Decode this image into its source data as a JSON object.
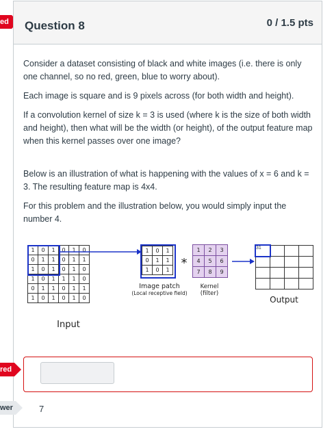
{
  "tags": {
    "top": "ed",
    "middle": "red",
    "bottom": "wer"
  },
  "question": {
    "title": "Question 8",
    "points": "0 / 1.5 pts",
    "p1": "Consider a dataset consisting of black and white images (i.e. there is only one channel, so no red, green, blue to worry about).",
    "p2": "Each image is square and is 9 pixels across (for both width and height).",
    "p3": "If a convolution kernel of size k = 3 is used (where k is the size of both width and height), then what will be the width (or height), of the output feature map when this kernel passes over one image?",
    "p4": "Below is an illustration of what is happening with the values of x = 6 and k = 3. The resulting feature map is 4x4.",
    "p5": "For this problem and the illustration below, you would simply input the number 4."
  },
  "figure": {
    "input_matrix": [
      [
        "1",
        "0",
        "1",
        "0",
        "1",
        "0"
      ],
      [
        "0",
        "1",
        "1",
        "0",
        "1",
        "1"
      ],
      [
        "1",
        "0",
        "1",
        "0",
        "1",
        "0"
      ],
      [
        "1",
        "0",
        "1",
        "1",
        "1",
        "0"
      ],
      [
        "0",
        "1",
        "1",
        "0",
        "1",
        "1"
      ],
      [
        "1",
        "0",
        "1",
        "0",
        "1",
        "0"
      ]
    ],
    "input_label": "Input",
    "patch_matrix": [
      [
        "1",
        "0",
        "1"
      ],
      [
        "0",
        "1",
        "1"
      ],
      [
        "1",
        "0",
        "1"
      ]
    ],
    "patch_label_1": "Image patch",
    "patch_label_2": "(Local receptive field)",
    "star": "*",
    "kernel_matrix": [
      [
        "1",
        "2",
        "3"
      ],
      [
        "4",
        "5",
        "6"
      ],
      [
        "7",
        "8",
        "9"
      ]
    ],
    "kernel_label_1": "Kernel",
    "kernel_label_2": "(filter)",
    "output_first_value": "31",
    "output_label": "Output"
  },
  "answer": {
    "input_value": "",
    "correct_answer": "7"
  }
}
